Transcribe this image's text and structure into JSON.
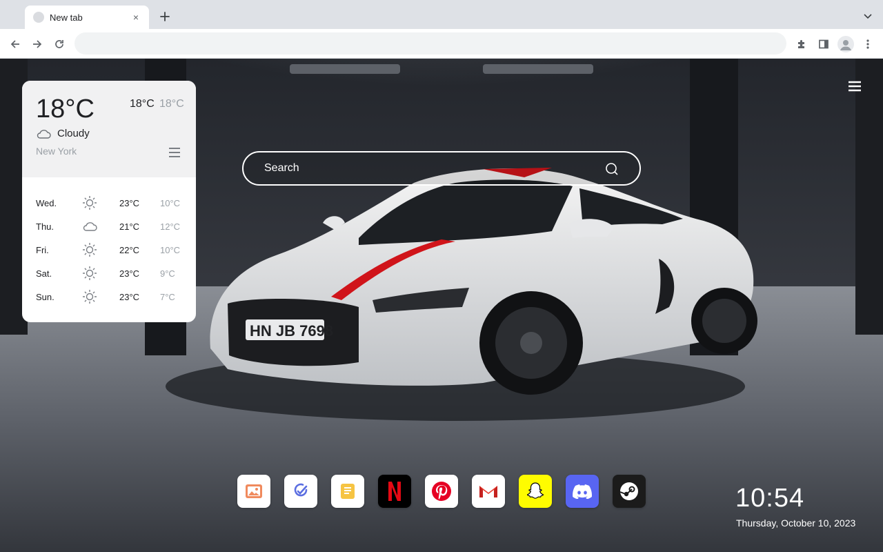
{
  "browser": {
    "tab": {
      "title": "New tab",
      "close_label": "×"
    },
    "new_tab_label": "+",
    "omnibox": {
      "value": "",
      "placeholder": ""
    }
  },
  "weather": {
    "current_temp": "18°C",
    "high": "18°C",
    "low": "18°C",
    "condition": "Cloudy",
    "condition_icon": "cloud-icon",
    "city": "New York",
    "forecast": [
      {
        "day": "Wed.",
        "icon": "sun-icon",
        "high": "23°C",
        "low": "10°C"
      },
      {
        "day": "Thu.",
        "icon": "cloud-icon",
        "high": "21°C",
        "low": "12°C"
      },
      {
        "day": "Fri.",
        "icon": "sun-icon",
        "high": "22°C",
        "low": "10°C"
      },
      {
        "day": "Sat.",
        "icon": "sun-icon",
        "high": "23°C",
        "low": "9°C"
      },
      {
        "day": "Sun.",
        "icon": "sun-icon",
        "high": "23°C",
        "low": "7°C"
      }
    ]
  },
  "search": {
    "placeholder": "Search"
  },
  "shortcuts": [
    {
      "name": "photos",
      "icon": "photos-icon",
      "color": "#ffffff"
    },
    {
      "name": "tasks",
      "icon": "tasks-icon",
      "color": "#ffffff"
    },
    {
      "name": "notes",
      "icon": "notes-icon",
      "color": "#ffffff"
    },
    {
      "name": "netflix",
      "icon": "netflix-icon",
      "color": "#000000"
    },
    {
      "name": "pinterest",
      "icon": "pinterest-icon",
      "color": "#ffffff"
    },
    {
      "name": "gmail",
      "icon": "gmail-icon",
      "color": "#ffffff"
    },
    {
      "name": "snapchat",
      "icon": "snapchat-icon",
      "color": "#fffc00"
    },
    {
      "name": "discord",
      "icon": "discord-icon",
      "color": "#5865f2"
    },
    {
      "name": "steam",
      "icon": "steam-icon",
      "color": "#1b1b1b"
    }
  ],
  "clock": {
    "time": "10:54",
    "date": "Thursday, October 10, 2023"
  },
  "colors": {
    "netflix_red": "#e50914",
    "pinterest_red": "#e60023",
    "stripe_red": "#d0141a"
  }
}
